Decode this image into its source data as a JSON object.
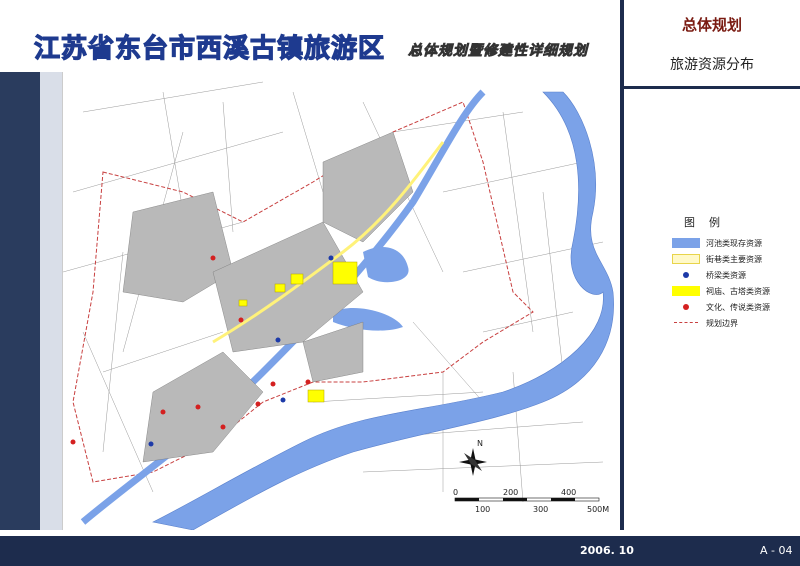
{
  "header": {
    "title": "江苏省东台市西溪古镇旅游区",
    "subtitle": "总体规划暨修建性详细规划"
  },
  "panel": {
    "section_title": "总体规划",
    "map_title": "旅游资源分布"
  },
  "legend": {
    "title": "图例",
    "items": [
      {
        "label": "河池类现存资源",
        "symbol": "water-swatch",
        "color": "#7ba2e8"
      },
      {
        "label": "街巷类主要资源",
        "symbol": "street-swatch",
        "color": "#fff27a"
      },
      {
        "label": "桥梁类资源",
        "symbol": "bridge-dot",
        "color": "#1d3aa8"
      },
      {
        "label": "祠庙、古塔类资源",
        "symbol": "temple-swatch",
        "color": "#ffff00"
      },
      {
        "label": "文化、传说类资源",
        "symbol": "culture-dot",
        "color": "#d42020"
      },
      {
        "label": "规划边界",
        "symbol": "boundary-line",
        "color": "#c84040"
      }
    ]
  },
  "scale": {
    "ticks_top": [
      "0",
      "200",
      "400"
    ],
    "ticks_bottom": [
      "100",
      "300",
      "500M"
    ]
  },
  "north_label": "N",
  "footer": {
    "date": "2006. 10",
    "sheet": "A - 04"
  }
}
